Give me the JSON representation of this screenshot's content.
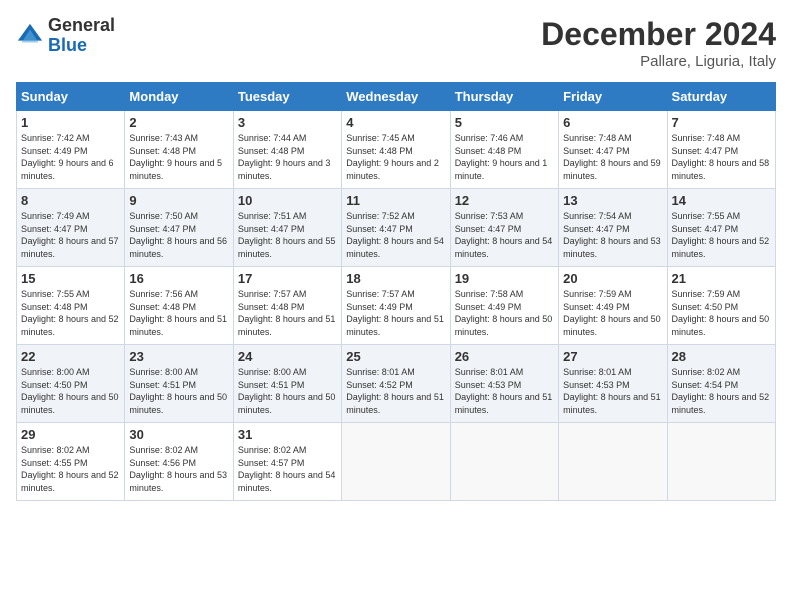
{
  "header": {
    "logo_general": "General",
    "logo_blue": "Blue",
    "month_title": "December 2024",
    "location": "Pallare, Liguria, Italy"
  },
  "days_of_week": [
    "Sunday",
    "Monday",
    "Tuesday",
    "Wednesday",
    "Thursday",
    "Friday",
    "Saturday"
  ],
  "weeks": [
    [
      {
        "day": 1,
        "sunrise": "7:42 AM",
        "sunset": "4:49 PM",
        "daylight": "9 hours and 6 minutes."
      },
      {
        "day": 2,
        "sunrise": "7:43 AM",
        "sunset": "4:48 PM",
        "daylight": "9 hours and 5 minutes."
      },
      {
        "day": 3,
        "sunrise": "7:44 AM",
        "sunset": "4:48 PM",
        "daylight": "9 hours and 3 minutes."
      },
      {
        "day": 4,
        "sunrise": "7:45 AM",
        "sunset": "4:48 PM",
        "daylight": "9 hours and 2 minutes."
      },
      {
        "day": 5,
        "sunrise": "7:46 AM",
        "sunset": "4:48 PM",
        "daylight": "9 hours and 1 minute."
      },
      {
        "day": 6,
        "sunrise": "7:48 AM",
        "sunset": "4:47 PM",
        "daylight": "8 hours and 59 minutes."
      },
      {
        "day": 7,
        "sunrise": "7:48 AM",
        "sunset": "4:47 PM",
        "daylight": "8 hours and 58 minutes."
      }
    ],
    [
      {
        "day": 8,
        "sunrise": "7:49 AM",
        "sunset": "4:47 PM",
        "daylight": "8 hours and 57 minutes."
      },
      {
        "day": 9,
        "sunrise": "7:50 AM",
        "sunset": "4:47 PM",
        "daylight": "8 hours and 56 minutes."
      },
      {
        "day": 10,
        "sunrise": "7:51 AM",
        "sunset": "4:47 PM",
        "daylight": "8 hours and 55 minutes."
      },
      {
        "day": 11,
        "sunrise": "7:52 AM",
        "sunset": "4:47 PM",
        "daylight": "8 hours and 54 minutes."
      },
      {
        "day": 12,
        "sunrise": "7:53 AM",
        "sunset": "4:47 PM",
        "daylight": "8 hours and 54 minutes."
      },
      {
        "day": 13,
        "sunrise": "7:54 AM",
        "sunset": "4:47 PM",
        "daylight": "8 hours and 53 minutes."
      },
      {
        "day": 14,
        "sunrise": "7:55 AM",
        "sunset": "4:47 PM",
        "daylight": "8 hours and 52 minutes."
      }
    ],
    [
      {
        "day": 15,
        "sunrise": "7:55 AM",
        "sunset": "4:48 PM",
        "daylight": "8 hours and 52 minutes."
      },
      {
        "day": 16,
        "sunrise": "7:56 AM",
        "sunset": "4:48 PM",
        "daylight": "8 hours and 51 minutes."
      },
      {
        "day": 17,
        "sunrise": "7:57 AM",
        "sunset": "4:48 PM",
        "daylight": "8 hours and 51 minutes."
      },
      {
        "day": 18,
        "sunrise": "7:57 AM",
        "sunset": "4:49 PM",
        "daylight": "8 hours and 51 minutes."
      },
      {
        "day": 19,
        "sunrise": "7:58 AM",
        "sunset": "4:49 PM",
        "daylight": "8 hours and 50 minutes."
      },
      {
        "day": 20,
        "sunrise": "7:59 AM",
        "sunset": "4:49 PM",
        "daylight": "8 hours and 50 minutes."
      },
      {
        "day": 21,
        "sunrise": "7:59 AM",
        "sunset": "4:50 PM",
        "daylight": "8 hours and 50 minutes."
      }
    ],
    [
      {
        "day": 22,
        "sunrise": "8:00 AM",
        "sunset": "4:50 PM",
        "daylight": "8 hours and 50 minutes."
      },
      {
        "day": 23,
        "sunrise": "8:00 AM",
        "sunset": "4:51 PM",
        "daylight": "8 hours and 50 minutes."
      },
      {
        "day": 24,
        "sunrise": "8:00 AM",
        "sunset": "4:51 PM",
        "daylight": "8 hours and 50 minutes."
      },
      {
        "day": 25,
        "sunrise": "8:01 AM",
        "sunset": "4:52 PM",
        "daylight": "8 hours and 51 minutes."
      },
      {
        "day": 26,
        "sunrise": "8:01 AM",
        "sunset": "4:53 PM",
        "daylight": "8 hours and 51 minutes."
      },
      {
        "day": 27,
        "sunrise": "8:01 AM",
        "sunset": "4:53 PM",
        "daylight": "8 hours and 51 minutes."
      },
      {
        "day": 28,
        "sunrise": "8:02 AM",
        "sunset": "4:54 PM",
        "daylight": "8 hours and 52 minutes."
      }
    ],
    [
      {
        "day": 29,
        "sunrise": "8:02 AM",
        "sunset": "4:55 PM",
        "daylight": "8 hours and 52 minutes."
      },
      {
        "day": 30,
        "sunrise": "8:02 AM",
        "sunset": "4:56 PM",
        "daylight": "8 hours and 53 minutes."
      },
      {
        "day": 31,
        "sunrise": "8:02 AM",
        "sunset": "4:57 PM",
        "daylight": "8 hours and 54 minutes."
      },
      null,
      null,
      null,
      null
    ]
  ]
}
